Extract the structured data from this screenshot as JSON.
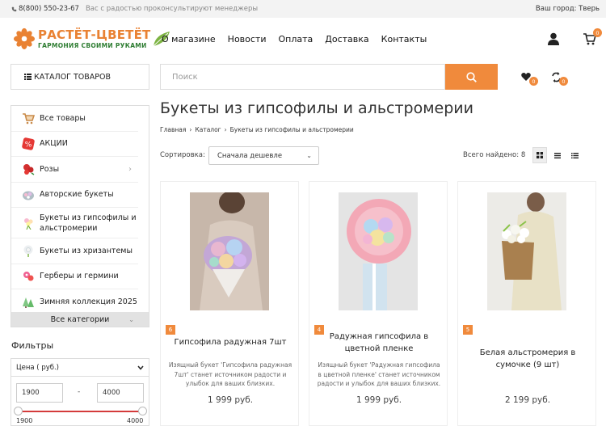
{
  "topbar": {
    "phone": "8(800) 550-23-67",
    "tagline": "Вас с радостью проконсультируют менеджеры",
    "city_label": "Ваш город:",
    "city": "Тверь"
  },
  "logo": {
    "title": "РАСТЁТ-ЦВЕТЁТ",
    "subtitle": "ГАРМОНИЯ СВОИМИ РУКАМИ"
  },
  "nav": [
    "О магазине",
    "Новости",
    "Оплата",
    "Доставка",
    "Контакты"
  ],
  "cart": {
    "count": "0"
  },
  "wishlist": {
    "count": "0"
  },
  "compare": {
    "count": "0"
  },
  "catalog_button": "КАТАЛОГ ТОВАРОВ",
  "search": {
    "placeholder": "Поиск"
  },
  "sidebar": {
    "items": [
      {
        "label": "Все товары",
        "icon": "cart-icon"
      },
      {
        "label": "АКЦИИ",
        "icon": "percent-icon"
      },
      {
        "label": "Розы",
        "icon": "rose-icon",
        "has_children": true
      },
      {
        "label": "Авторские букеты",
        "icon": "bouquet-icon"
      },
      {
        "label": "Букеты из гипсофилы и альстромерии",
        "icon": "gypsophila-icon"
      },
      {
        "label": "Букеты из хризантемы",
        "icon": "chrysanthemum-icon"
      },
      {
        "label": "Герберы и гермини",
        "icon": "gerbera-icon"
      },
      {
        "label": "Зимняя коллекция 2025",
        "icon": "tree-icon"
      }
    ],
    "all_label": "Все категории"
  },
  "filters": {
    "title": "Фильтры",
    "price": {
      "label": "Цена ( руб.)",
      "min_value": "1900",
      "max_value": "4000",
      "separator": "-",
      "range_min": "1900",
      "range_max": "4000"
    }
  },
  "page": {
    "title": "Букеты из гипсофилы и альстромерии",
    "breadcrumbs": [
      "Главная",
      "Каталог",
      "Букеты из гипсофилы и альстромерии"
    ]
  },
  "sort": {
    "label": "Сортировка:",
    "selected": "Сначала дешевле"
  },
  "found": "Всего найдено: 8",
  "products": [
    {
      "badge": "6",
      "name": "Гипсофила радужная 7шт",
      "description": "Изящный букет 'Гипсофила радужная 7шт' станет источником радости и улыбок для ваших близких.",
      "price": "1 999 руб."
    },
    {
      "badge": "4",
      "name": "Радужная гипсофила в цветной пленке",
      "description": "Изящный букет 'Радужная гипсофила в цветной пленке' станет источником радости и улыбок для ваших близких.",
      "price": "1 999 руб."
    },
    {
      "badge": "5",
      "name": "Белая альстромерия в сумочке (9 шт)",
      "description": "",
      "price": "2 199 руб."
    }
  ],
  "colors": {
    "accent": "#f08a3c",
    "logo_green": "#2e7d32"
  }
}
